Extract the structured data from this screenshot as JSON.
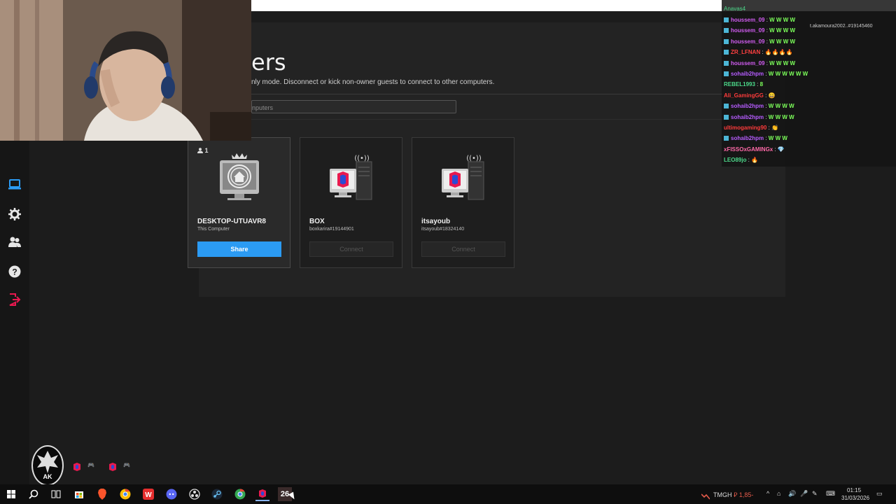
{
  "page": {
    "heading": "ers",
    "subtitle": "nly mode. Disconnect or kick non-owner guests to connect to other computers.",
    "search_placeholder": "nputers"
  },
  "sidebar": {
    "items": [
      {
        "icon": "computer-icon",
        "active": true
      },
      {
        "icon": "gear-icon"
      },
      {
        "icon": "users-icon"
      },
      {
        "icon": "help-icon"
      },
      {
        "icon": "logout-icon"
      }
    ]
  },
  "computers": [
    {
      "name": "DESKTOP-UTUAVR8",
      "sub": "This Computer",
      "guests": "1",
      "button": "Share",
      "type": "host"
    },
    {
      "name": "BOX",
      "sub": "boxkarira#19144901",
      "button": "Connect",
      "type": "remote"
    },
    {
      "name": "itsayoub",
      "sub": "itsayoub#18324140",
      "button": "Connect",
      "type": "remote"
    }
  ],
  "chat": {
    "top_user": "Anavas4",
    "extra": "t.akamoura2002..#19145460",
    "lines": [
      {
        "user": "houssem_09",
        "color": "#d05cf0",
        "msg": "W W W W"
      },
      {
        "user": "houssem_09",
        "color": "#d05cf0",
        "msg": "W W W W"
      },
      {
        "user": "houssem_09",
        "color": "#d05cf0",
        "msg": "W W W W"
      },
      {
        "user": "ZR_LFNAN",
        "color": "#ff4040",
        "msg": "🔥🔥🔥🔥"
      },
      {
        "user": "houssem_09",
        "color": "#d05cf0",
        "msg": "W W W W"
      },
      {
        "user": "sohaib2hpm",
        "color": "#b65cff",
        "msg": "W W W W W W"
      },
      {
        "user": "REBEL1993",
        "color": "#4cd98a",
        "msg": "8"
      },
      {
        "user": "Ali_GamingGG",
        "color": "#ff3b3b",
        "msg": "😄"
      },
      {
        "user": "sohaib2hpm",
        "color": "#b65cff",
        "msg": "W W W W"
      },
      {
        "user": "sohaib2hpm",
        "color": "#b65cff",
        "msg": "W W W W"
      },
      {
        "user": "ultimogaming90",
        "color": "#ff3b3b",
        "msg": "👏"
      },
      {
        "user": "sohaib2hpm",
        "color": "#b65cff",
        "msg": "W W W"
      },
      {
        "user": "xFISSOxGAMINGx",
        "color": "#ff6aa8",
        "msg": "💎"
      },
      {
        "user": "LEO89jo",
        "color": "#4cd98a",
        "msg": "🔥"
      }
    ]
  },
  "taskbar": {
    "apps": [
      "start-icon",
      "search-icon",
      "task-view-icon",
      "store-icon",
      "brave-icon",
      "chrome-icon",
      "wps-icon",
      "discord-icon",
      "obs-icon",
      "steam-icon",
      "chrome2-icon",
      "parsec-icon",
      "counter-icon"
    ],
    "counter_label": "26",
    "stock_name": "TMGH",
    "stock_change": "⃄ 1,85-",
    "time": "01:15",
    "date": "31/03/2026"
  },
  "colors": {
    "accent": "#2b9bf4",
    "parsec_pink": "#e8194f"
  }
}
